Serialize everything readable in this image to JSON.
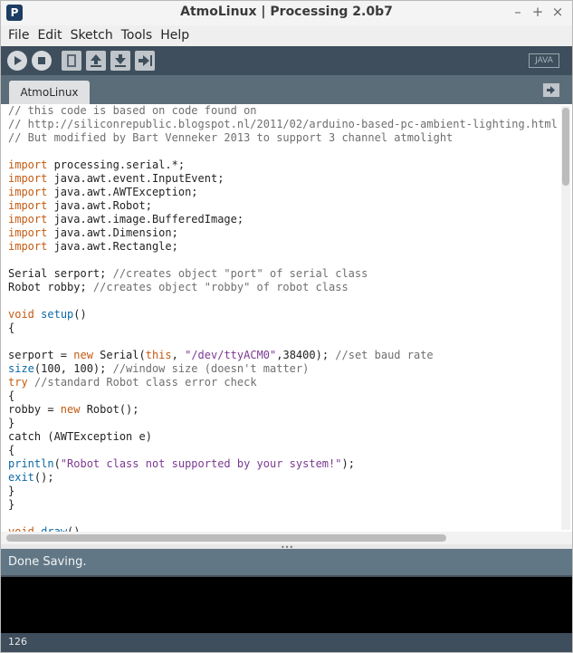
{
  "window": {
    "title": "AtmoLinux | Processing 2.0b7",
    "icon_letter": "P",
    "controls": [
      "–",
      "+",
      "×"
    ]
  },
  "menu": [
    "File",
    "Edit",
    "Sketch",
    "Tools",
    "Help"
  ],
  "toolbar": {
    "buttons": [
      "run",
      "stop",
      "new",
      "open",
      "save",
      "export"
    ],
    "mode_label": "JAVA"
  },
  "tabs": [
    "AtmoLinux"
  ],
  "editor": {
    "lines": [
      [
        {
          "t": "// this code is based on code found on",
          "c": "comment"
        }
      ],
      [
        {
          "t": "// http://siliconrepublic.blogspot.nl/2011/02/arduino-based-pc-ambient-lighting.html",
          "c": "comment"
        }
      ],
      [
        {
          "t": "// But modified by Bart Venneker 2013 to support 3 channel atmolight",
          "c": "comment"
        }
      ],
      [],
      [
        {
          "t": "import",
          "c": "kw"
        },
        {
          "t": " processing.serial.*;",
          "c": ""
        }
      ],
      [
        {
          "t": "import",
          "c": "kw"
        },
        {
          "t": " java.awt.event.InputEvent;",
          "c": ""
        }
      ],
      [
        {
          "t": "import",
          "c": "kw"
        },
        {
          "t": " java.awt.AWTException;",
          "c": ""
        }
      ],
      [
        {
          "t": "import",
          "c": "kw"
        },
        {
          "t": " java.awt.Robot;",
          "c": ""
        }
      ],
      [
        {
          "t": "import",
          "c": "kw"
        },
        {
          "t": " java.awt.image.BufferedImage;",
          "c": ""
        }
      ],
      [
        {
          "t": "import",
          "c": "kw"
        },
        {
          "t": " java.awt.Dimension;",
          "c": ""
        }
      ],
      [
        {
          "t": "import",
          "c": "kw"
        },
        {
          "t": " java.awt.Rectangle;",
          "c": ""
        }
      ],
      [],
      [
        {
          "t": "Serial serport; ",
          "c": ""
        },
        {
          "t": "//creates object \"port\" of serial class",
          "c": "comment"
        }
      ],
      [
        {
          "t": "Robot robby; ",
          "c": ""
        },
        {
          "t": "//creates object \"robby\" of robot class",
          "c": "comment"
        }
      ],
      [],
      [
        {
          "t": "void",
          "c": "kw"
        },
        {
          "t": " ",
          "c": ""
        },
        {
          "t": "setup",
          "c": "fn"
        },
        {
          "t": "()",
          "c": ""
        }
      ],
      [
        {
          "t": "{",
          "c": ""
        }
      ],
      [],
      [
        {
          "t": "serport = ",
          "c": ""
        },
        {
          "t": "new",
          "c": "kw"
        },
        {
          "t": " Serial(",
          "c": ""
        },
        {
          "t": "this",
          "c": "kw"
        },
        {
          "t": ", ",
          "c": ""
        },
        {
          "t": "\"/dev/ttyACM0\"",
          "c": "str"
        },
        {
          "t": ",38400); ",
          "c": ""
        },
        {
          "t": "//set baud rate",
          "c": "comment"
        }
      ],
      [
        {
          "t": "size",
          "c": "fn"
        },
        {
          "t": "(100, 100); ",
          "c": ""
        },
        {
          "t": "//window size (doesn't matter)",
          "c": "comment"
        }
      ],
      [
        {
          "t": "try",
          "c": "kw"
        },
        {
          "t": " ",
          "c": ""
        },
        {
          "t": "//standard Robot class error check",
          "c": "comment"
        }
      ],
      [
        {
          "t": "{",
          "c": ""
        }
      ],
      [
        {
          "t": "robby = ",
          "c": ""
        },
        {
          "t": "new",
          "c": "kw"
        },
        {
          "t": " Robot();",
          "c": ""
        }
      ],
      [
        {
          "t": "}",
          "c": ""
        }
      ],
      [
        {
          "t": "catch (AWTException e)",
          "c": ""
        }
      ],
      [
        {
          "t": "{",
          "c": ""
        }
      ],
      [
        {
          "t": "println",
          "c": "fn"
        },
        {
          "t": "(",
          "c": ""
        },
        {
          "t": "\"Robot class not supported by your system!\"",
          "c": "str"
        },
        {
          "t": ");",
          "c": ""
        }
      ],
      [
        {
          "t": "exit",
          "c": "fn"
        },
        {
          "t": "();",
          "c": ""
        }
      ],
      [
        {
          "t": "}",
          "c": ""
        }
      ],
      [
        {
          "t": "}",
          "c": ""
        }
      ],
      [],
      [
        {
          "t": "void",
          "c": "kw"
        },
        {
          "t": " ",
          "c": ""
        },
        {
          "t": "draw",
          "c": "fn"
        },
        {
          "t": "()",
          "c": ""
        }
      ]
    ]
  },
  "status": {
    "message": "Done Saving.",
    "line_number": "126"
  },
  "colors": {
    "toolbar": "#3e4e5c",
    "tabstrip": "#5c6d7a",
    "status": "#627785",
    "keyword": "#c45b12",
    "function": "#0b69a5",
    "string": "#7b3a92",
    "comment": "#6f6f6f"
  }
}
